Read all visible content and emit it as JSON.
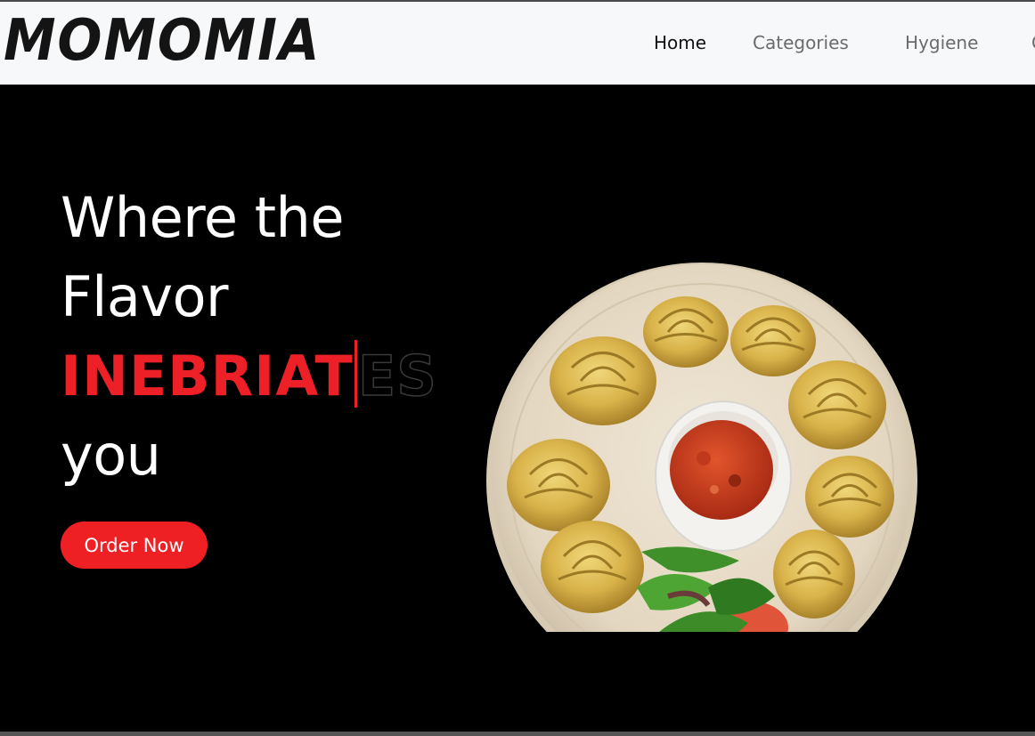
{
  "brand": {
    "logo_text": "MOMOMIA"
  },
  "nav": {
    "items": [
      {
        "label": "Home",
        "active": true
      },
      {
        "label": "Categories",
        "active": false
      },
      {
        "label": "Hygiene",
        "active": false
      },
      {
        "label": "C",
        "active": false
      }
    ]
  },
  "hero": {
    "line1": "Where the",
    "line2": "Flavor",
    "typed_text": "INEBRIAT",
    "ghost_text": "ES",
    "line4": "you",
    "cta_label": "Order Now",
    "image_alt": "Plate of momos with chutney dip and salad"
  },
  "colors": {
    "accent": "#ee2027",
    "background": "#000000",
    "navbar": "#f7f8fa",
    "text_light": "#ffffff",
    "text_dark": "#141414",
    "nav_inactive": "#6b6b6b"
  }
}
